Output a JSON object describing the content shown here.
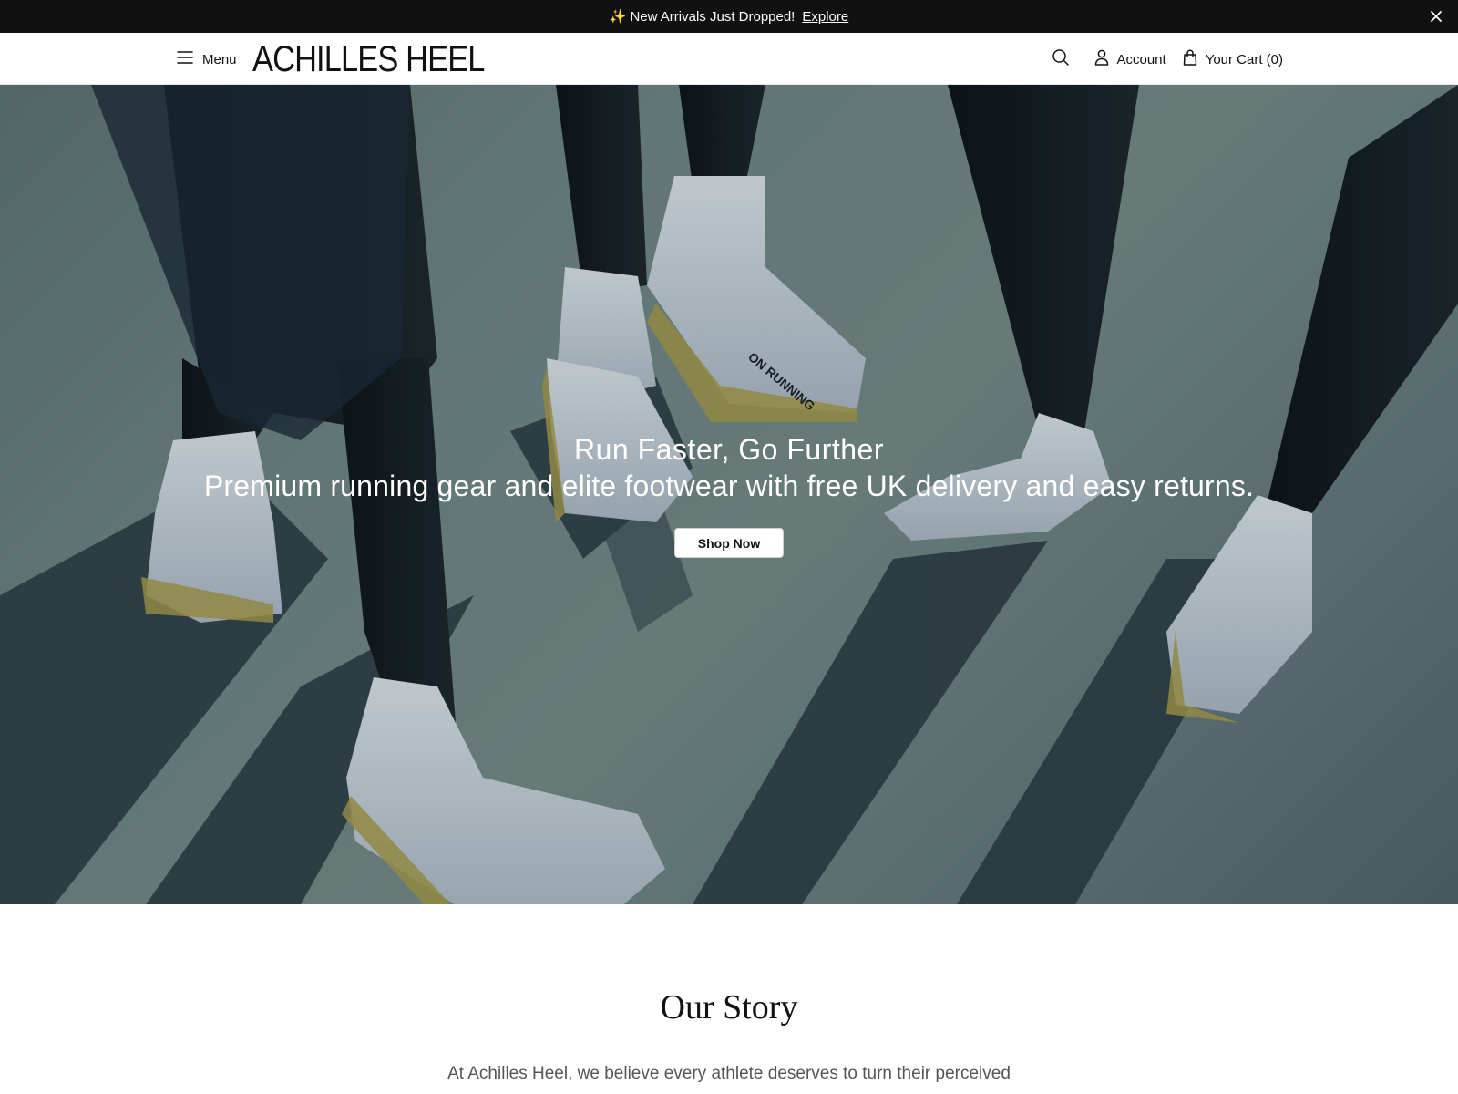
{
  "announcement": {
    "sparkle": "✨",
    "message": "New Arrivals Just Dropped!",
    "link_label": "Explore"
  },
  "header": {
    "menu_label": "Menu",
    "logo_text": "ACHILLES HEEL",
    "account_label": "Account",
    "cart_label": "Your Cart (0)"
  },
  "hero": {
    "title": "Run Faster, Go Further",
    "subtitle": "Premium running gear and elite footwear with free UK delivery and easy returns.",
    "cta_label": "Shop Now",
    "shoe_brand_text": "ON RUNNING"
  },
  "story": {
    "title": "Our Story",
    "text": "At Achilles Heel, we believe every athlete deserves to turn their perceived"
  },
  "colors": {
    "announcement_bg": "#111111",
    "hero_tint": "#6e8583",
    "cta_bg": "#ffffff"
  },
  "icons": {
    "menu": "hamburger-icon",
    "search": "search-icon",
    "account": "user-icon",
    "cart": "shopping-bag-icon",
    "close": "close-icon"
  }
}
